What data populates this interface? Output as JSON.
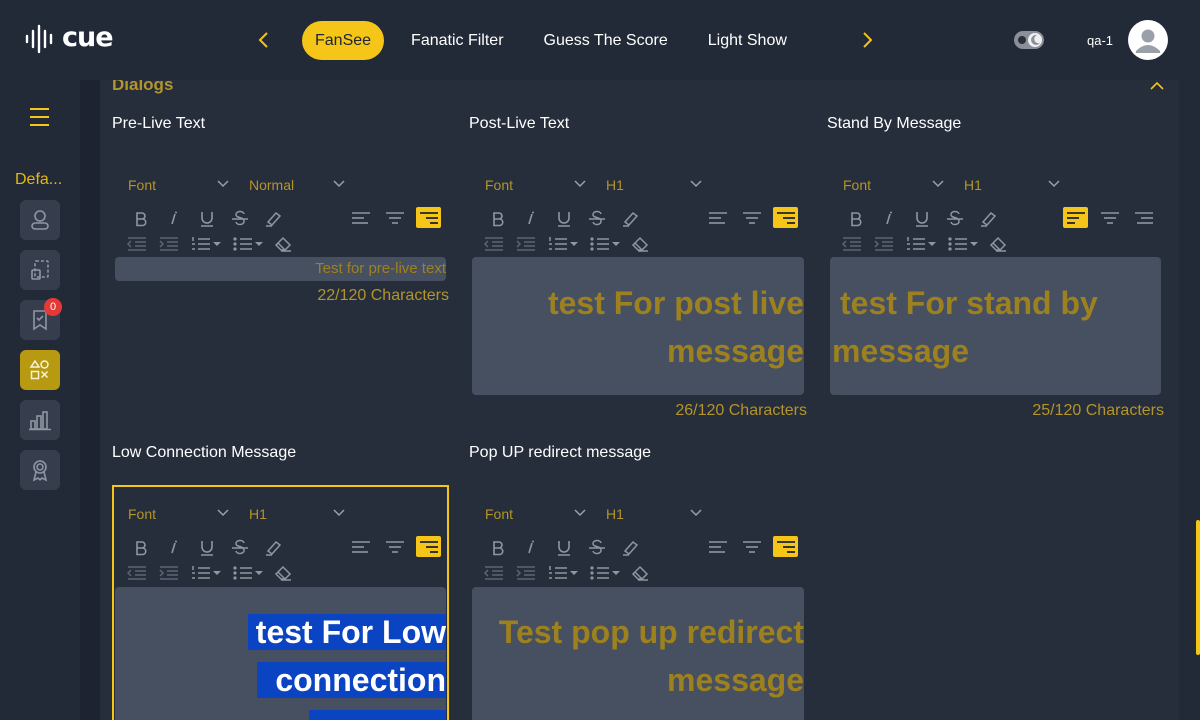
{
  "header": {
    "logo_text": "cue",
    "tabs": [
      {
        "label": "FanSee",
        "active": true
      },
      {
        "label": "Fanatic Filter",
        "active": false
      },
      {
        "label": "Guess The Score",
        "active": false
      },
      {
        "label": "Light Show",
        "active": false
      }
    ],
    "user_name": "qa-1"
  },
  "sidebar": {
    "default_label": "Defa...",
    "notification_count": "0",
    "items": [
      {
        "icon": "user-icon"
      },
      {
        "icon": "screen-select-icon"
      },
      {
        "icon": "bookmark-icon"
      },
      {
        "icon": "shapes-icon"
      },
      {
        "icon": "bar-chart-icon"
      },
      {
        "icon": "award-icon"
      }
    ]
  },
  "section": {
    "title": "Dialogs"
  },
  "editors": [
    {
      "label": "Pre-Live Text",
      "font": "Font",
      "size": "Normal",
      "text": "Test for pre-live text",
      "count": "22/120 Characters"
    },
    {
      "label": "Post-Live Text",
      "font": "Font",
      "size": "H1",
      "text": "test For post live message",
      "count": "26/120 Characters"
    },
    {
      "label": "Stand By Message",
      "font": "Font",
      "size": "H1",
      "text": "test For stand by message",
      "count": "25/120 Characters"
    },
    {
      "label": "Low Connection Message",
      "font": "Font",
      "size": "H1",
      "text_line1": "test For Low",
      "text_line2": "connection message"
    },
    {
      "label": "Pop UP redirect message",
      "font": "Font",
      "size": "H1",
      "text": "Test pop up redirect message"
    }
  ],
  "colors": {
    "accent": "#f5c518",
    "background": "#222937",
    "editor_bg": "#465060",
    "muted_gold": "#b3952a",
    "selection": "#0a44c2"
  }
}
